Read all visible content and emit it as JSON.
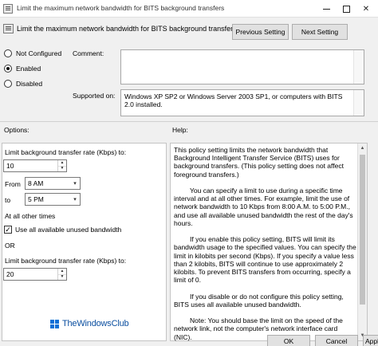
{
  "window": {
    "title": "Limit the maximum network bandwidth for BITS background transfers"
  },
  "header": {
    "title": "Limit the maximum network bandwidth for BITS background transfers",
    "previous_label": "Previous Setting",
    "next_label": "Next Setting"
  },
  "state": {
    "options": [
      {
        "label": "Not Configured",
        "checked": false
      },
      {
        "label": "Enabled",
        "checked": true
      },
      {
        "label": "Disabled",
        "checked": false
      }
    ]
  },
  "comment": {
    "label": "Comment:",
    "value": ""
  },
  "supported": {
    "label": "Supported on:",
    "value": "Windows XP SP2 or Windows Server 2003 SP1, or computers with BITS 2.0 installed."
  },
  "options_section": {
    "label": "Options:",
    "rate_label": "Limit background transfer rate (Kbps) to:",
    "rate_value": "10",
    "from_label": "From",
    "from_value": "8 AM",
    "to_label": "to",
    "to_value": "5 PM",
    "other_times_label": "At all other times",
    "use_all_label": "Use all available unused bandwidth",
    "use_all_checked": true,
    "or_label": "OR",
    "rate2_label": "Limit background transfer rate (Kbps) to:",
    "rate2_value": "20"
  },
  "help_section": {
    "label": "Help:",
    "paragraphs": [
      "This policy setting limits the network bandwidth that Background Intelligent Transfer Service (BITS) uses for background transfers. (This policy setting does not affect foreground transfers.)",
      "You can specify a limit to use during a specific time interval and at all other times. For example, limit the use of network bandwidth to 10 Kbps from 8:00 A.M. to 5:00 P.M., and use all available unused bandwidth the rest of the day's hours.",
      "If you enable this policy setting, BITS will limit its bandwidth usage to the specified values. You can specify the limit in kilobits per second (Kbps). If you specify a value less than 2 kilobits, BITS will continue to use approximately 2 kilobits. To prevent BITS transfers from occurring, specify a limit of 0.",
      "If you disable or do not configure this policy setting, BITS uses all available unused bandwidth.",
      "Note: You should base the limit on the speed of the network link, not the computer's network interface card (NIC)."
    ]
  },
  "watermark": {
    "text": "TheWindowsClub"
  },
  "footer": {
    "ok_label": "OK",
    "cancel_label": "Cancel",
    "apply_label": "Apply"
  },
  "colors": {
    "window_bg": "#f0f0f0",
    "watermark_blue": "#0b4fa0"
  }
}
